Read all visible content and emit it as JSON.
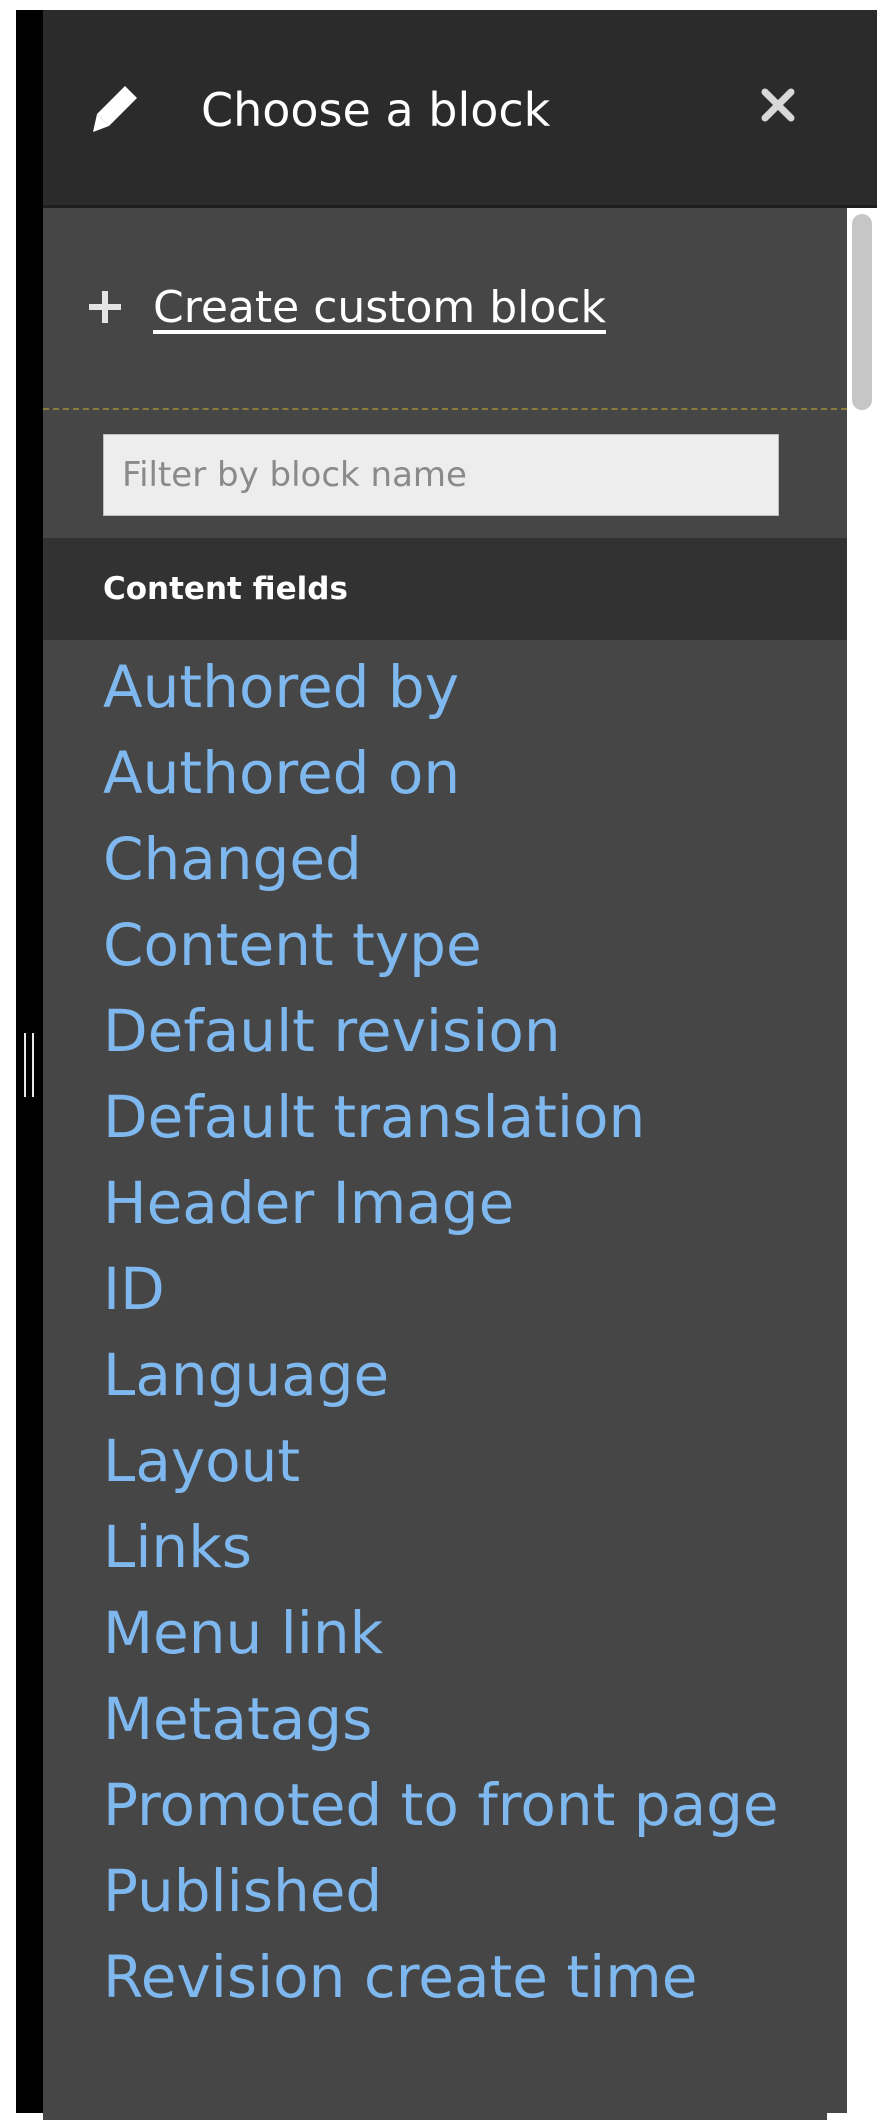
{
  "header": {
    "title": "Choose a block",
    "edit_icon": "pencil-icon",
    "close_icon": "close-icon"
  },
  "create": {
    "icon": "plus-icon",
    "label": "Create custom block"
  },
  "filter": {
    "placeholder": "Filter by block name",
    "value": ""
  },
  "section": {
    "title": "Content fields",
    "items": [
      {
        "label": "Authored by"
      },
      {
        "label": "Authored on"
      },
      {
        "label": "Changed"
      },
      {
        "label": "Content type"
      },
      {
        "label": "Default revision"
      },
      {
        "label": "Default translation"
      },
      {
        "label": "Header Image"
      },
      {
        "label": "ID"
      },
      {
        "label": "Language"
      },
      {
        "label": "Layout"
      },
      {
        "label": "Links"
      },
      {
        "label": "Menu link"
      },
      {
        "label": "Metatags"
      },
      {
        "label": "Promoted to front page"
      },
      {
        "label": "Published"
      },
      {
        "label": "Revision create time"
      }
    ]
  },
  "colors": {
    "tray_bg": "#464646",
    "header_bg": "#2b2b2b",
    "section_bg": "#323232",
    "link": "#7fb8ee"
  }
}
